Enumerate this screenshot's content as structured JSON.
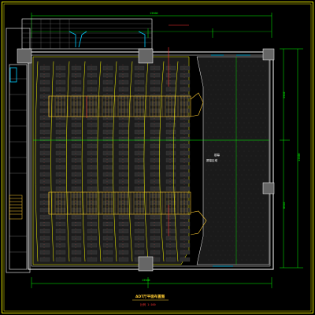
{
  "drawing": {
    "title": "ADT厅平面布置图",
    "scale_note": "比例 1:100",
    "view_label": "屏幕区域",
    "screen_label": "银幕",
    "dims": {
      "top_total": "13500",
      "bottom_total": "13500",
      "right_total": "13500",
      "right_upper": "3950",
      "right_lower": "8950"
    },
    "colors": {
      "background": "#000000",
      "frame": "#ffff00",
      "walls": "#ffffff",
      "dimension": "#00ff00",
      "accent": "#ff3333",
      "seating": "#1b1b1b",
      "stairs": "#ffcc33",
      "doors": "#00ffff"
    }
  }
}
